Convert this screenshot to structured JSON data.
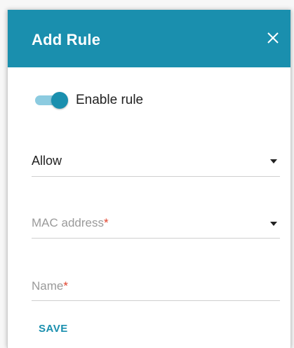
{
  "dialog": {
    "title": "Add Rule",
    "close_icon": "close-icon"
  },
  "toggle": {
    "label": "Enable rule",
    "state": "on"
  },
  "action_select": {
    "selected": "Allow",
    "icon": "chevron-down-icon"
  },
  "mac_field": {
    "placeholder": "MAC address",
    "required_mark": "*",
    "icon": "chevron-down-icon"
  },
  "name_field": {
    "placeholder": "Name",
    "required_mark": "*"
  },
  "save_label": "SAVE",
  "colors": {
    "accent": "#1a8fae",
    "required": "#e0412b",
    "toggle_track": "#8ccbe0"
  }
}
